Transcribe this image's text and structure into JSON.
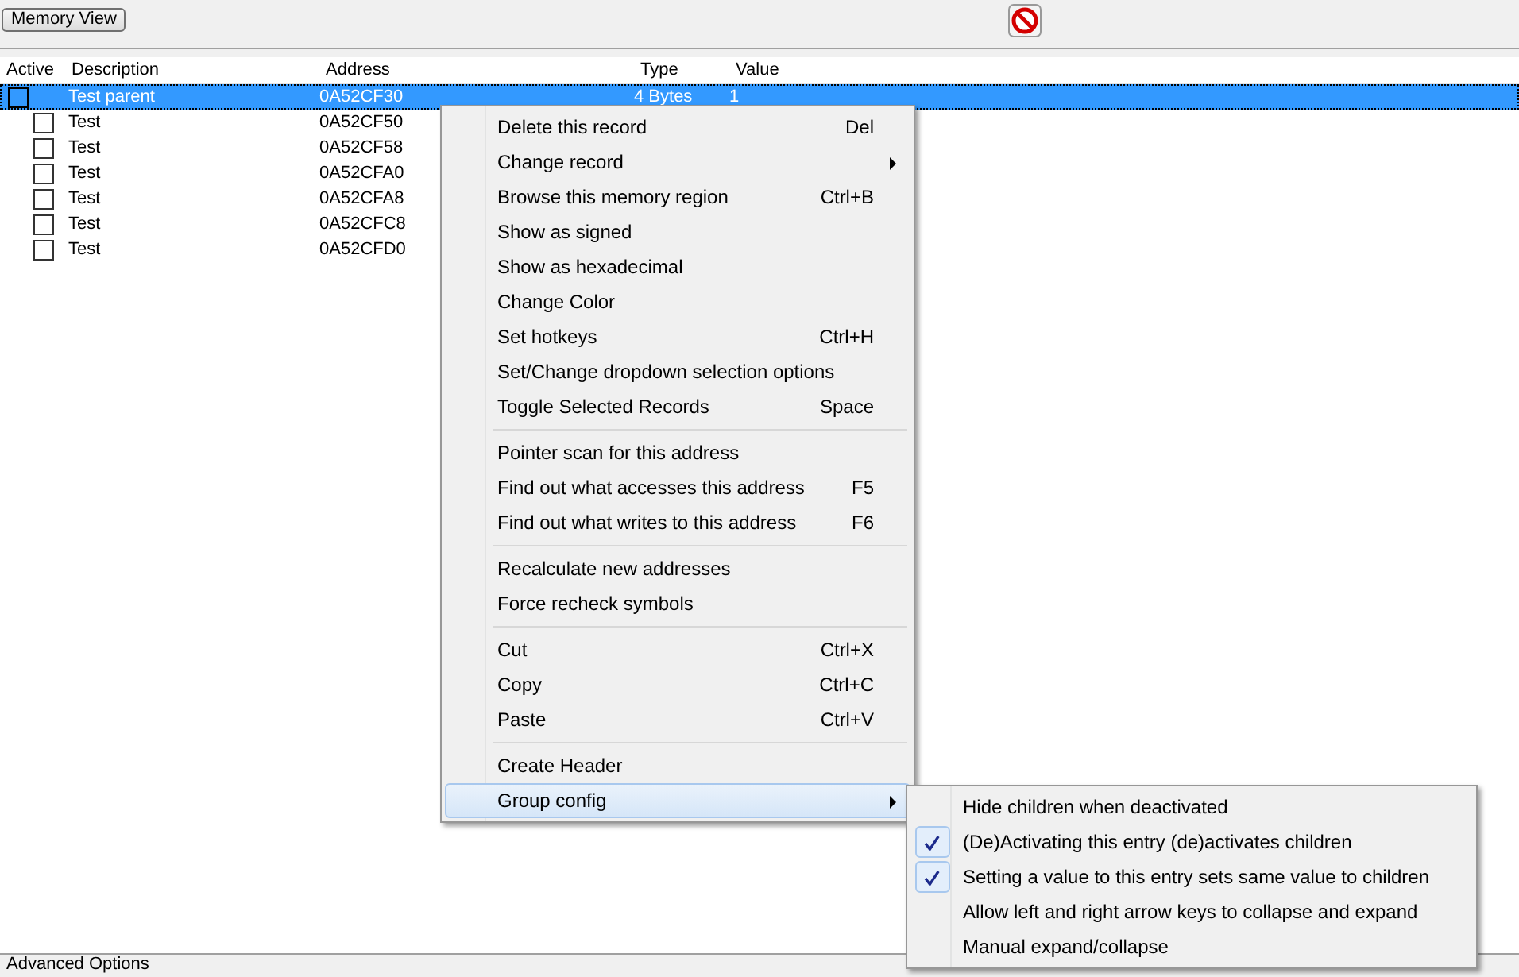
{
  "toolbar": {
    "memory_view_button": "Memory View"
  },
  "table": {
    "columns": [
      "Active",
      "Description",
      "Address",
      "Type",
      "Value"
    ],
    "rows": [
      {
        "active": false,
        "selected": true,
        "description": "Test parent",
        "address": "0A52CF30",
        "type": "4 Bytes",
        "value": "1",
        "children": [
          {
            "active": false,
            "selected": false,
            "description": "Test",
            "address": "0A52CF50"
          },
          {
            "active": false,
            "selected": false,
            "description": "Test",
            "address": "0A52CF58"
          },
          {
            "active": false,
            "selected": false,
            "description": "Test",
            "address": "0A52CFA0"
          },
          {
            "active": false,
            "selected": false,
            "description": "Test",
            "address": "0A52CFA8"
          },
          {
            "active": false,
            "selected": false,
            "description": "Test",
            "address": "0A52CFC8"
          },
          {
            "active": false,
            "selected": false,
            "description": "Test",
            "address": "0A52CFD0"
          }
        ]
      }
    ]
  },
  "context_menu": {
    "groups": [
      [
        {
          "label": "Delete this record",
          "shortcut": "Del",
          "submenu": false,
          "selected": false
        },
        {
          "label": "Change record",
          "submenu": true,
          "selected": false
        },
        {
          "label": "Browse this memory region",
          "shortcut": "Ctrl+B",
          "submenu": false,
          "selected": false
        },
        {
          "label": "Show as signed",
          "submenu": false,
          "selected": false
        },
        {
          "label": "Show as hexadecimal",
          "submenu": false,
          "selected": false
        },
        {
          "label": "Change Color",
          "submenu": false,
          "selected": false
        },
        {
          "label": "Set hotkeys",
          "shortcut": "Ctrl+H",
          "submenu": false,
          "selected": false
        },
        {
          "label": "Set/Change dropdown selection options",
          "submenu": false,
          "selected": false
        },
        {
          "label": "Toggle Selected Records",
          "shortcut": "Space",
          "submenu": false,
          "selected": false
        }
      ],
      [
        {
          "label": "Pointer scan for this address",
          "submenu": false,
          "selected": false
        },
        {
          "label": "Find out what accesses this address",
          "shortcut": "F5",
          "submenu": false,
          "selected": false
        },
        {
          "label": "Find out what writes to this address",
          "shortcut": "F6",
          "submenu": false,
          "selected": false
        }
      ],
      [
        {
          "label": "Recalculate new addresses",
          "submenu": false,
          "selected": false
        },
        {
          "label": "Force recheck symbols",
          "submenu": false,
          "selected": false
        }
      ],
      [
        {
          "label": "Cut",
          "shortcut": "Ctrl+X",
          "submenu": false,
          "selected": false
        },
        {
          "label": "Copy",
          "shortcut": "Ctrl+C",
          "submenu": false,
          "selected": false
        },
        {
          "label": "Paste",
          "shortcut": "Ctrl+V",
          "submenu": false,
          "selected": false
        }
      ],
      [
        {
          "label": "Create Header",
          "submenu": false,
          "selected": false
        },
        {
          "label": "Group config",
          "submenu": true,
          "selected": true
        }
      ]
    ]
  },
  "submenu": {
    "items": [
      {
        "label": "Hide children when deactivated",
        "checked": false
      },
      {
        "label": "(De)Activating this entry (de)activates children",
        "checked": true
      },
      {
        "label": "Setting a value to this entry sets same value to children",
        "checked": true
      },
      {
        "label": "Allow left and right arrow keys to collapse and expand",
        "checked": false
      },
      {
        "label": "Manual expand/collapse",
        "checked": false
      }
    ]
  },
  "status_bar": {
    "label": "Advanced Options"
  }
}
